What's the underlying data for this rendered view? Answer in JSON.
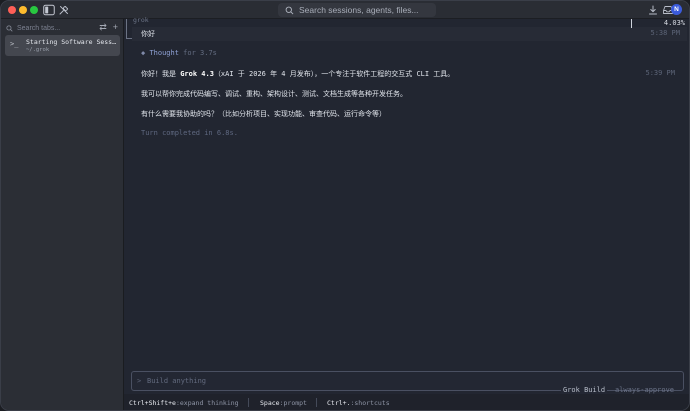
{
  "titlebar": {
    "search_placeholder": "Search sessions, agents, files...",
    "avatar_initial": "N"
  },
  "sidebar": {
    "search_placeholder": "Search tabs...",
    "swap_glyph": "⇄",
    "add_glyph": "+",
    "sessions": [
      {
        "title": "Starting Software Sessio...",
        "subtitle": "~/.grok"
      }
    ]
  },
  "conversation": {
    "banner_label": "grok",
    "context_percent": "4.03%",
    "user_message": "你好",
    "user_time": "5:38 PM",
    "thought_label": "Thought",
    "thought_duration": "for 3.7s",
    "response_line1_prefix": "你好！我是 ",
    "response_line1_bold": "Grok 4.3",
    "response_line1_suffix": "（xAI 于 2026 年 4 月发布），一个专注于软件工程的交互式 CLI 工具。",
    "response_time": "5:39 PM",
    "response_line2": "我可以帮你完成代码编写、调试、重构、架构设计、测试、文档生成等各种开发任务。",
    "response_line3": "有什么需要我协助的吗？（比如分析项目、实现功能、审查代码、运行命令等）",
    "turn_status": "Turn completed in 6.8s."
  },
  "input": {
    "prompt_glyph": ">",
    "placeholder": "Build anything",
    "mode": "Grok Build",
    "approval": "always-approve"
  },
  "statusbar": {
    "items": [
      {
        "key": "Ctrl+Shift+e",
        "action": ":expand thinking"
      },
      {
        "key": "Space",
        "action": ":prompt"
      },
      {
        "key": "Ctrl+.",
        "action": ":shortcuts"
      }
    ]
  }
}
